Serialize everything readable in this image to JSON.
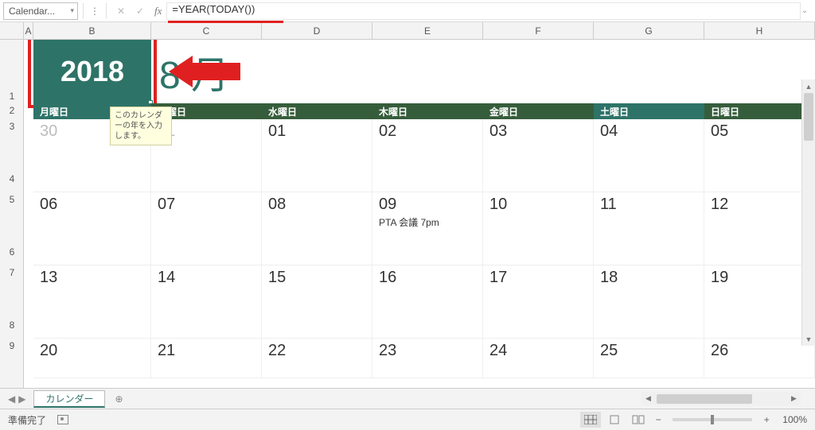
{
  "formula_bar": {
    "name_box": "Calendar...",
    "fx_label": "fx",
    "formula": "=YEAR(TODAY())"
  },
  "columns": [
    "A",
    "B",
    "C",
    "D",
    "E",
    "F",
    "G",
    "H"
  ],
  "row_numbers_visible": [
    "1",
    "2",
    "3",
    "4",
    "5",
    "6",
    "7",
    "8",
    "9"
  ],
  "calendar": {
    "year": "2018",
    "month_display": "8 月",
    "tooltip": "このカレンダーの年を入力します。",
    "weekdays": [
      "月曜日",
      "火曜日",
      "水曜日",
      "木曜日",
      "金曜日",
      "土曜日",
      "日曜日"
    ],
    "rows": [
      {
        "days": [
          {
            "num": "30",
            "grey": true
          },
          {
            "num": "31",
            "grey": true
          },
          {
            "num": "01"
          },
          {
            "num": "02"
          },
          {
            "num": "03"
          },
          {
            "num": "04"
          },
          {
            "num": "05"
          }
        ]
      },
      {
        "days": [
          {
            "num": "06"
          },
          {
            "num": "07"
          },
          {
            "num": "08"
          },
          {
            "num": "09",
            "event": "PTA 会議 7pm"
          },
          {
            "num": "10"
          },
          {
            "num": "11"
          },
          {
            "num": "12"
          }
        ]
      },
      {
        "days": [
          {
            "num": "13"
          },
          {
            "num": "14"
          },
          {
            "num": "15"
          },
          {
            "num": "16"
          },
          {
            "num": "17"
          },
          {
            "num": "18"
          },
          {
            "num": "19"
          }
        ]
      },
      {
        "days": [
          {
            "num": "20"
          },
          {
            "num": "21"
          },
          {
            "num": "22"
          },
          {
            "num": "23"
          },
          {
            "num": "24"
          },
          {
            "num": "25"
          },
          {
            "num": "26"
          }
        ]
      }
    ]
  },
  "sheet_tabs": {
    "active": "カレンダー",
    "add_glyph": "⊕"
  },
  "status_bar": {
    "ready": "準備完了",
    "zoom": "100%",
    "minus": "−",
    "plus": "+"
  },
  "glyphs": {
    "dd": "▾",
    "x": "✕",
    "check": "✓",
    "up": "▲",
    "down": "▼",
    "left": "◀",
    "right": "▶",
    "first": "⏮",
    "last": "⏭",
    "dots": "⋮",
    "expand": "⌄"
  }
}
